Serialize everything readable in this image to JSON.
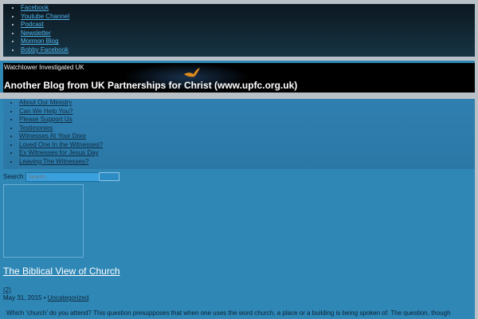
{
  "social_links": [
    "Facebook",
    "Youtube Channel",
    "Podcast",
    "Newsletter",
    "Mormon Blog",
    "Bobby Facebook"
  ],
  "header": {
    "site_name": "Watchtower Investigated UK",
    "blog_title": "Another Blog from UK Partnerships for Christ (www.upfc.org.uk)"
  },
  "nav_items": [
    "About Our Ministry",
    "Can We Help You?",
    "Please Support Us",
    "Testimonies",
    "Witnesses At Your Door",
    "Loved One In the Witnesses?",
    "Ex Witnesses for Jesus Day",
    "Leaving The Witnesses?"
  ],
  "search": {
    "label": "Search",
    "placeholder": "Search..."
  },
  "post": {
    "title": "The Biblical View of Church",
    "comments": "(2)",
    "date": "May 31, 2015",
    "meta_sep": " • ",
    "category": "Uncategorized",
    "excerpt": "Which ‘church’ do you attend? This question presupposes that when one uses the word church, a place or a building is being spoken of.  The question, though"
  },
  "colors": {
    "page_bg": "#2f87b6",
    "header_bg": "#000000",
    "accent_bird": "#e08a1e"
  }
}
